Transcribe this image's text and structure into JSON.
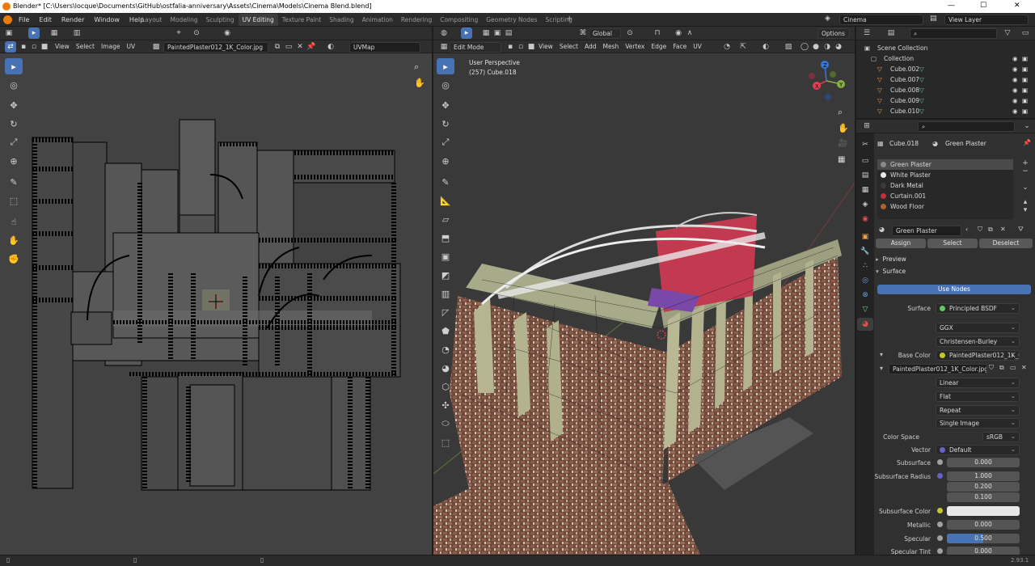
{
  "window": {
    "title": "Blender* [C:\\Users\\locque\\Documents\\GitHub\\ostfalia-anniversary\\Assets\\Cinema\\Models\\Cinema Blend.blend]"
  },
  "menu": [
    "File",
    "Edit",
    "Render",
    "Window",
    "Help"
  ],
  "workspaces": [
    "Layout",
    "Modeling",
    "Sculpting",
    "UV Editing",
    "Texture Paint",
    "Shading",
    "Animation",
    "Rendering",
    "Compositing",
    "Geometry Nodes",
    "Scripting"
  ],
  "workspace_active": "UV Editing",
  "top_right": {
    "scene": "Cinema",
    "view_layer": "View Layer"
  },
  "uv_editor": {
    "menus": [
      "View",
      "Select",
      "Image",
      "UV"
    ],
    "image_name": "PaintedPlaster012_1K_Color.jpg",
    "uvmap": "UVMap"
  },
  "viewport": {
    "mode": "Edit Mode",
    "menus": [
      "View",
      "Select",
      "Add",
      "Mesh",
      "Vertex",
      "Edge",
      "Face",
      "UV"
    ],
    "transform_orientation": "Global",
    "options_label": "Options",
    "overlay_line1": "User Perspective",
    "overlay_line2": "(257) Cube.018",
    "axes": {
      "x": "X",
      "y": "Y",
      "z": "Z"
    }
  },
  "outliner": {
    "items": [
      {
        "label": "Scene Collection"
      },
      {
        "label": "Collection"
      },
      {
        "label": "Cube.002"
      },
      {
        "label": "Cube.007"
      },
      {
        "label": "Cube.008"
      },
      {
        "label": "Cube.009"
      },
      {
        "label": "Cube.010"
      }
    ]
  },
  "properties": {
    "object_name": "Cube.018",
    "material_name": "Green Plaster",
    "materials": [
      {
        "name": "Green Plaster",
        "color": "#8a8a8a"
      },
      {
        "name": "White Plaster",
        "color": "#e8e8e8"
      },
      {
        "name": "Dark Metal",
        "color": "#3a3a3a"
      },
      {
        "name": "Curtain.001",
        "color": "#c03040"
      },
      {
        "name": "Wood Floor",
        "color": "#b06030"
      }
    ],
    "slot_material": "Green Plaster",
    "assign_label": "Assign",
    "select_label": "Select",
    "deselect_label": "Deselect",
    "preview_label": "Preview",
    "surface_panel_label": "Surface",
    "use_nodes_label": "Use Nodes",
    "surface_label": "Surface",
    "surface_value": "Principled BSDF",
    "distribution": "GGX",
    "subsurface_method": "Christensen-Burley",
    "base_color_label": "Base Color",
    "base_color_value": "PaintedPlaster012_1K_C...",
    "image_name": "PaintedPlaster012_1K_Color.jpg",
    "interpolation": "Linear",
    "projection": "Flat",
    "extension": "Repeat",
    "source": "Single Image",
    "color_space_label": "Color Space",
    "color_space": "sRGB",
    "vector_label": "Vector",
    "vector_value": "Default",
    "subsurface_label": "Subsurface",
    "subsurface_value": "0.000",
    "subsurface_radius_label": "Subsurface Radius",
    "subsurface_radius": [
      "1.000",
      "0.200",
      "0.100"
    ],
    "subsurface_color_label": "Subsurface Color",
    "metallic_label": "Metallic",
    "metallic_value": "0.000",
    "specular_label": "Specular",
    "specular_value": "0.500",
    "specular_fill": 0.5,
    "specular_tint_label": "Specular Tint",
    "specular_tint_value": "0.000"
  },
  "status": {
    "version": "2.93.1"
  },
  "colors": {
    "accent": "#4772b3",
    "header": "#2e2e2e",
    "panel": "#303030",
    "uv_bg": "#424242",
    "viewport_bg": "#393939"
  }
}
